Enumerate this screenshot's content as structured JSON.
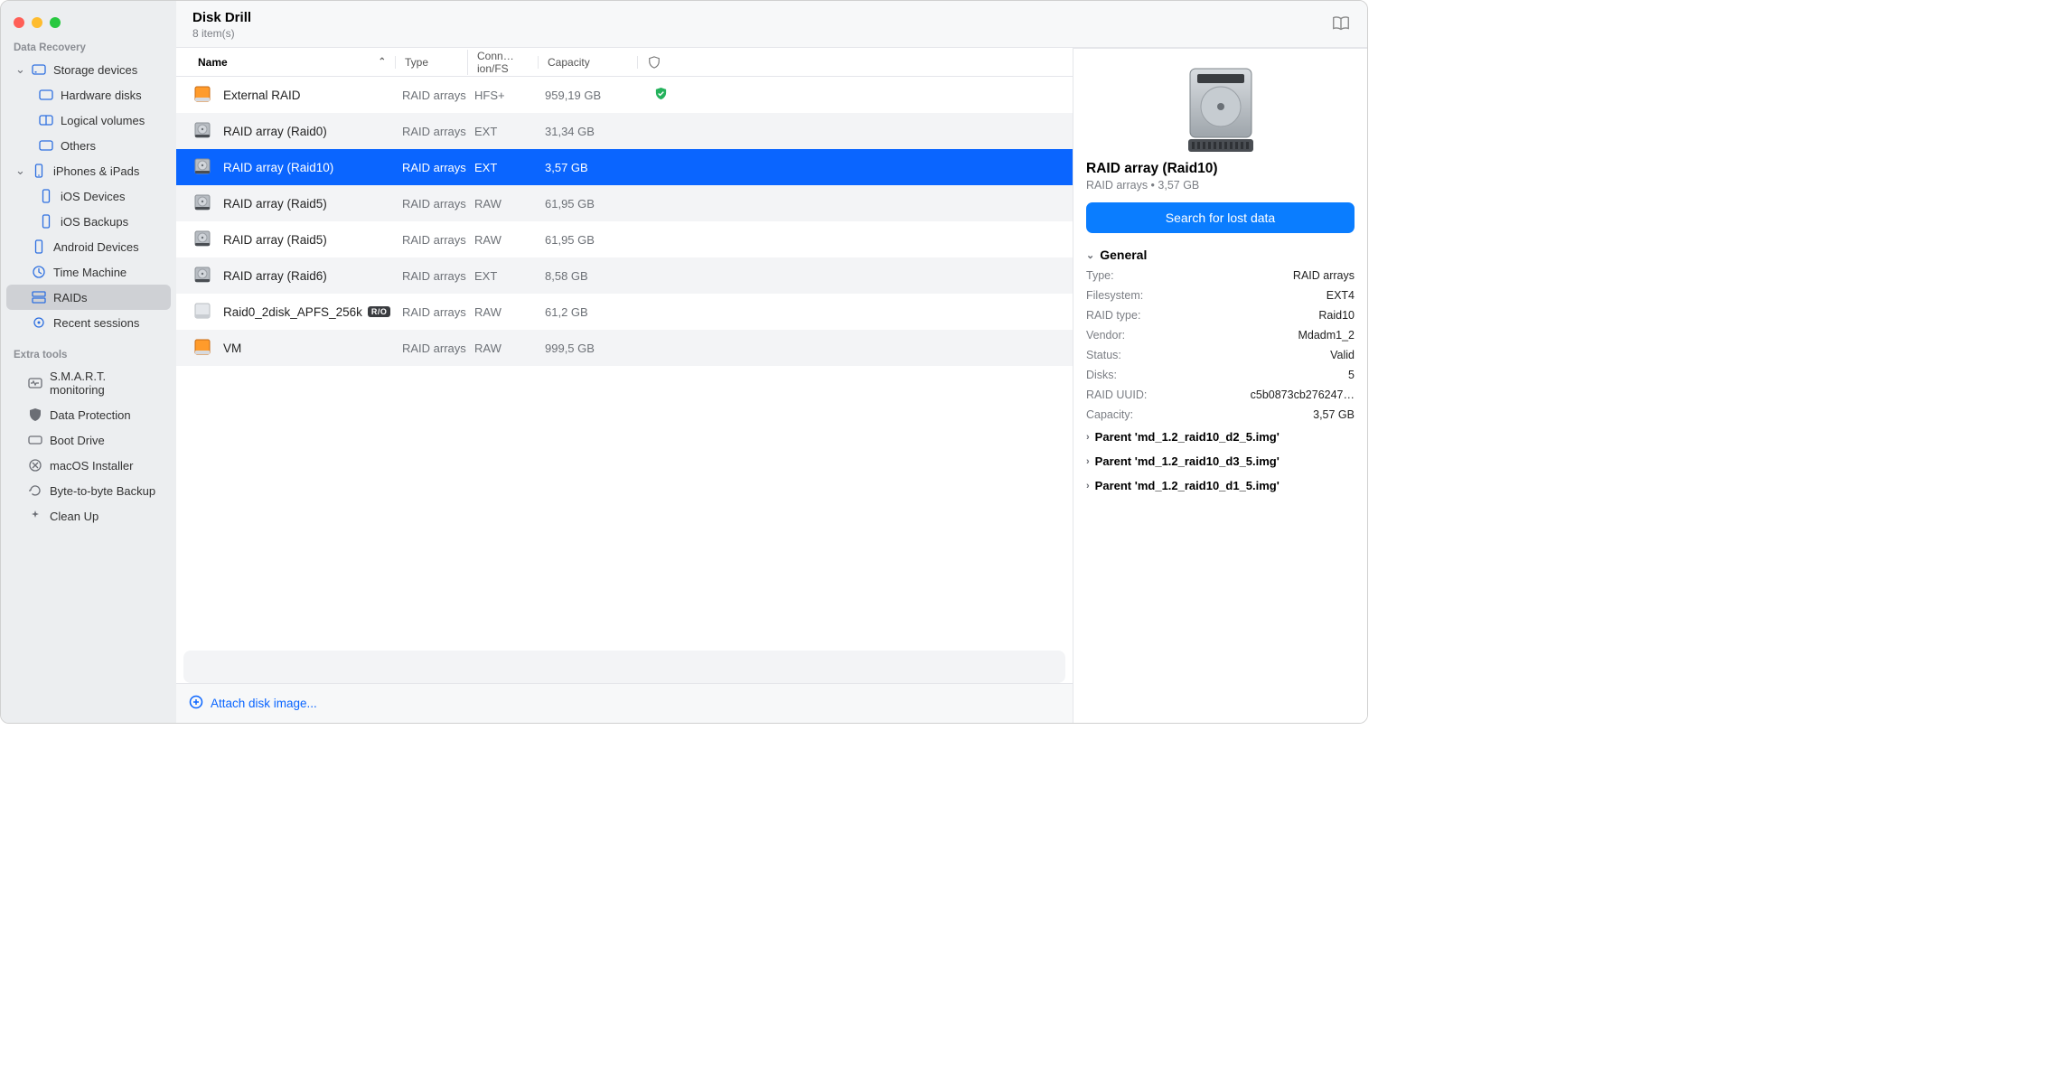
{
  "header": {
    "app_title": "Disk Drill",
    "item_count": "8 item(s)"
  },
  "sidebar": {
    "section1_label": "Data Recovery",
    "storage_devices": "Storage devices",
    "hardware_disks": "Hardware disks",
    "logical_volumes": "Logical volumes",
    "others": "Others",
    "iphones_ipads": "iPhones & iPads",
    "ios_devices": "iOS Devices",
    "ios_backups": "iOS Backups",
    "android": "Android Devices",
    "time_machine": "Time Machine",
    "raids": "RAIDs",
    "recent_sessions": "Recent sessions",
    "section2_label": "Extra tools",
    "smart": "S.M.A.R.T. monitoring",
    "data_protection": "Data Protection",
    "boot_drive": "Boot Drive",
    "macos_installer": "macOS Installer",
    "byte_backup": "Byte-to-byte Backup",
    "clean_up": "Clean Up"
  },
  "columns": {
    "name": "Name",
    "type": "Type",
    "conn": "Conn…ion/FS",
    "capacity": "Capacity"
  },
  "rows": [
    {
      "name": "External RAID",
      "type": "RAID arrays",
      "conn": "HFS+",
      "cap": "959,19 GB",
      "icon": "orange",
      "shield": true,
      "selected": false
    },
    {
      "name": "RAID array (Raid0)",
      "type": "RAID arrays",
      "conn": "EXT",
      "cap": "31,34 GB",
      "icon": "gray",
      "selected": false
    },
    {
      "name": "RAID array (Raid10)",
      "type": "RAID arrays",
      "conn": "EXT",
      "cap": "3,57 GB",
      "icon": "gray",
      "selected": true
    },
    {
      "name": "RAID array (Raid5)",
      "type": "RAID arrays",
      "conn": "RAW",
      "cap": "61,95 GB",
      "icon": "gray",
      "selected": false
    },
    {
      "name": "RAID array (Raid5)",
      "type": "RAID arrays",
      "conn": "RAW",
      "cap": "61,95 GB",
      "icon": "gray",
      "selected": false
    },
    {
      "name": "RAID array (Raid6)",
      "type": "RAID arrays",
      "conn": "EXT",
      "cap": "8,58 GB",
      "icon": "gray",
      "selected": false
    },
    {
      "name": "Raid0_2disk_APFS_256k",
      "type": "RAID arrays",
      "conn": "RAW",
      "cap": "61,2 GB",
      "icon": "silver",
      "ro": true,
      "selected": false
    },
    {
      "name": "VM",
      "type": "RAID arrays",
      "conn": "RAW",
      "cap": "999,5 GB",
      "icon": "orange",
      "selected": false
    }
  ],
  "ro_badge": "R/O",
  "attach_label": "Attach disk image...",
  "details": {
    "title": "RAID array (Raid10)",
    "subtitle": "RAID arrays • 3,57 GB",
    "search_btn": "Search for lost data",
    "general_label": "General",
    "type_k": "Type:",
    "type_v": "RAID arrays",
    "fs_k": "Filesystem:",
    "fs_v": "EXT4",
    "raidtype_k": "RAID type:",
    "raidtype_v": "Raid10",
    "vendor_k": "Vendor:",
    "vendor_v": "Mdadm1_2",
    "status_k": "Status:",
    "status_v": "Valid",
    "disks_k": "Disks:",
    "disks_v": "5",
    "uuid_k": "RAID UUID:",
    "uuid_v": "c5b0873cb276247…",
    "capacity_k": "Capacity:",
    "capacity_v": "3,57 GB",
    "parents": [
      "Parent 'md_1.2_raid10_d2_5.img'",
      "Parent 'md_1.2_raid10_d3_5.img'",
      "Parent 'md_1.2_raid10_d1_5.img'"
    ]
  }
}
